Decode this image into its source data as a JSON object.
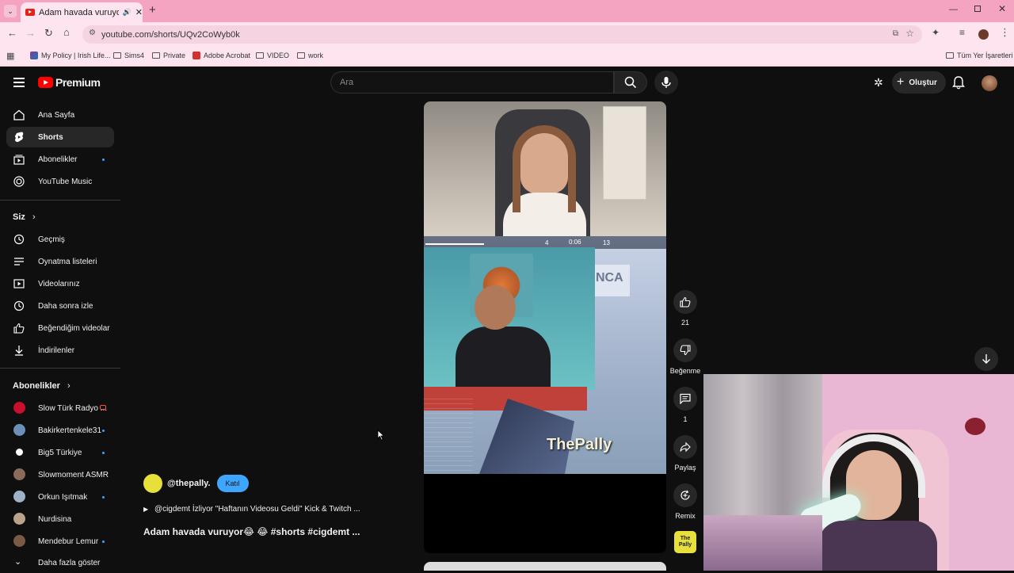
{
  "browser": {
    "tab_title": "Adam havada vuruyor😂 😂",
    "url": "youtube.com/shorts/UQv2CoWyb0k",
    "bookmarks": [
      {
        "label": "My Policy | Irish Life..."
      },
      {
        "label": "Sims4"
      },
      {
        "label": "Private"
      },
      {
        "label": "Adobe Acrobat"
      },
      {
        "label": "VIDEO"
      },
      {
        "label": "work"
      }
    ],
    "all_bookmarks": "Tüm Yer İşaretleri"
  },
  "header": {
    "logo_text": "Premium",
    "search_placeholder": "Ara",
    "create_label": "Oluştur"
  },
  "sidebar": {
    "main": [
      {
        "label": "Ana Sayfa",
        "icon": "home-icon"
      },
      {
        "label": "Shorts",
        "icon": "shorts-icon",
        "active": true
      },
      {
        "label": "Abonelikler",
        "icon": "subscriptions-icon",
        "dot": true
      },
      {
        "label": "YouTube Music",
        "icon": "music-icon"
      }
    ],
    "you_title": "Siz",
    "you": [
      {
        "label": "Geçmiş",
        "icon": "history-icon"
      },
      {
        "label": "Oynatma listeleri",
        "icon": "playlists-icon"
      },
      {
        "label": "Videolarınız",
        "icon": "your-videos-icon"
      },
      {
        "label": "Daha sonra izle",
        "icon": "watch-later-icon"
      },
      {
        "label": "Beğendiğim videolar",
        "icon": "liked-icon"
      },
      {
        "label": "İndirilenler",
        "icon": "downloads-icon"
      }
    ],
    "subs_title": "Abonelikler",
    "subs": [
      {
        "label": "Slow Türk Radyo ...",
        "color": "#c8102e",
        "live": true
      },
      {
        "label": "Bakirkertenkele31",
        "color": "#6b8fb5",
        "dot": true
      },
      {
        "label": "Big5 Türkiye",
        "color": "#ffffff",
        "dot": true
      },
      {
        "label": "Slowmoment ASMR",
        "color": "#8a6a5a"
      },
      {
        "label": "Orkun Işıtmak",
        "color": "#9fb3c8",
        "dot": true
      },
      {
        "label": "Nurdisina",
        "color": "#b9a38a"
      },
      {
        "label": "Mendebur Lemur",
        "color": "#7a5a45",
        "dot": true
      }
    ],
    "show_more": "Daha fazla göster"
  },
  "short": {
    "channel": "@thepally.",
    "join_label": "Katıl",
    "description": "@cigdemt İzliyor \"Haftanın Videosu Geldi\" Kick & Twitch ...",
    "title": "Adam havada vuruyor😂 😂 #shorts #cigdemt ...",
    "watermark": "ThePally",
    "game_timer": "0:06",
    "score_left": "4",
    "score_right": "13",
    "banner_text": "NCA",
    "channel_avatar": "The Pally"
  },
  "actions": {
    "like_count": "21",
    "dislike_label": "Beğenme",
    "comment_count": "1",
    "share_label": "Paylaş",
    "remix_label": "Remix"
  },
  "colors": {
    "accent_red": "#ff0000",
    "active_blue": "#3ea6ff",
    "join_blue": "#3ea6ff",
    "tab_pink": "#f4a4c0"
  }
}
